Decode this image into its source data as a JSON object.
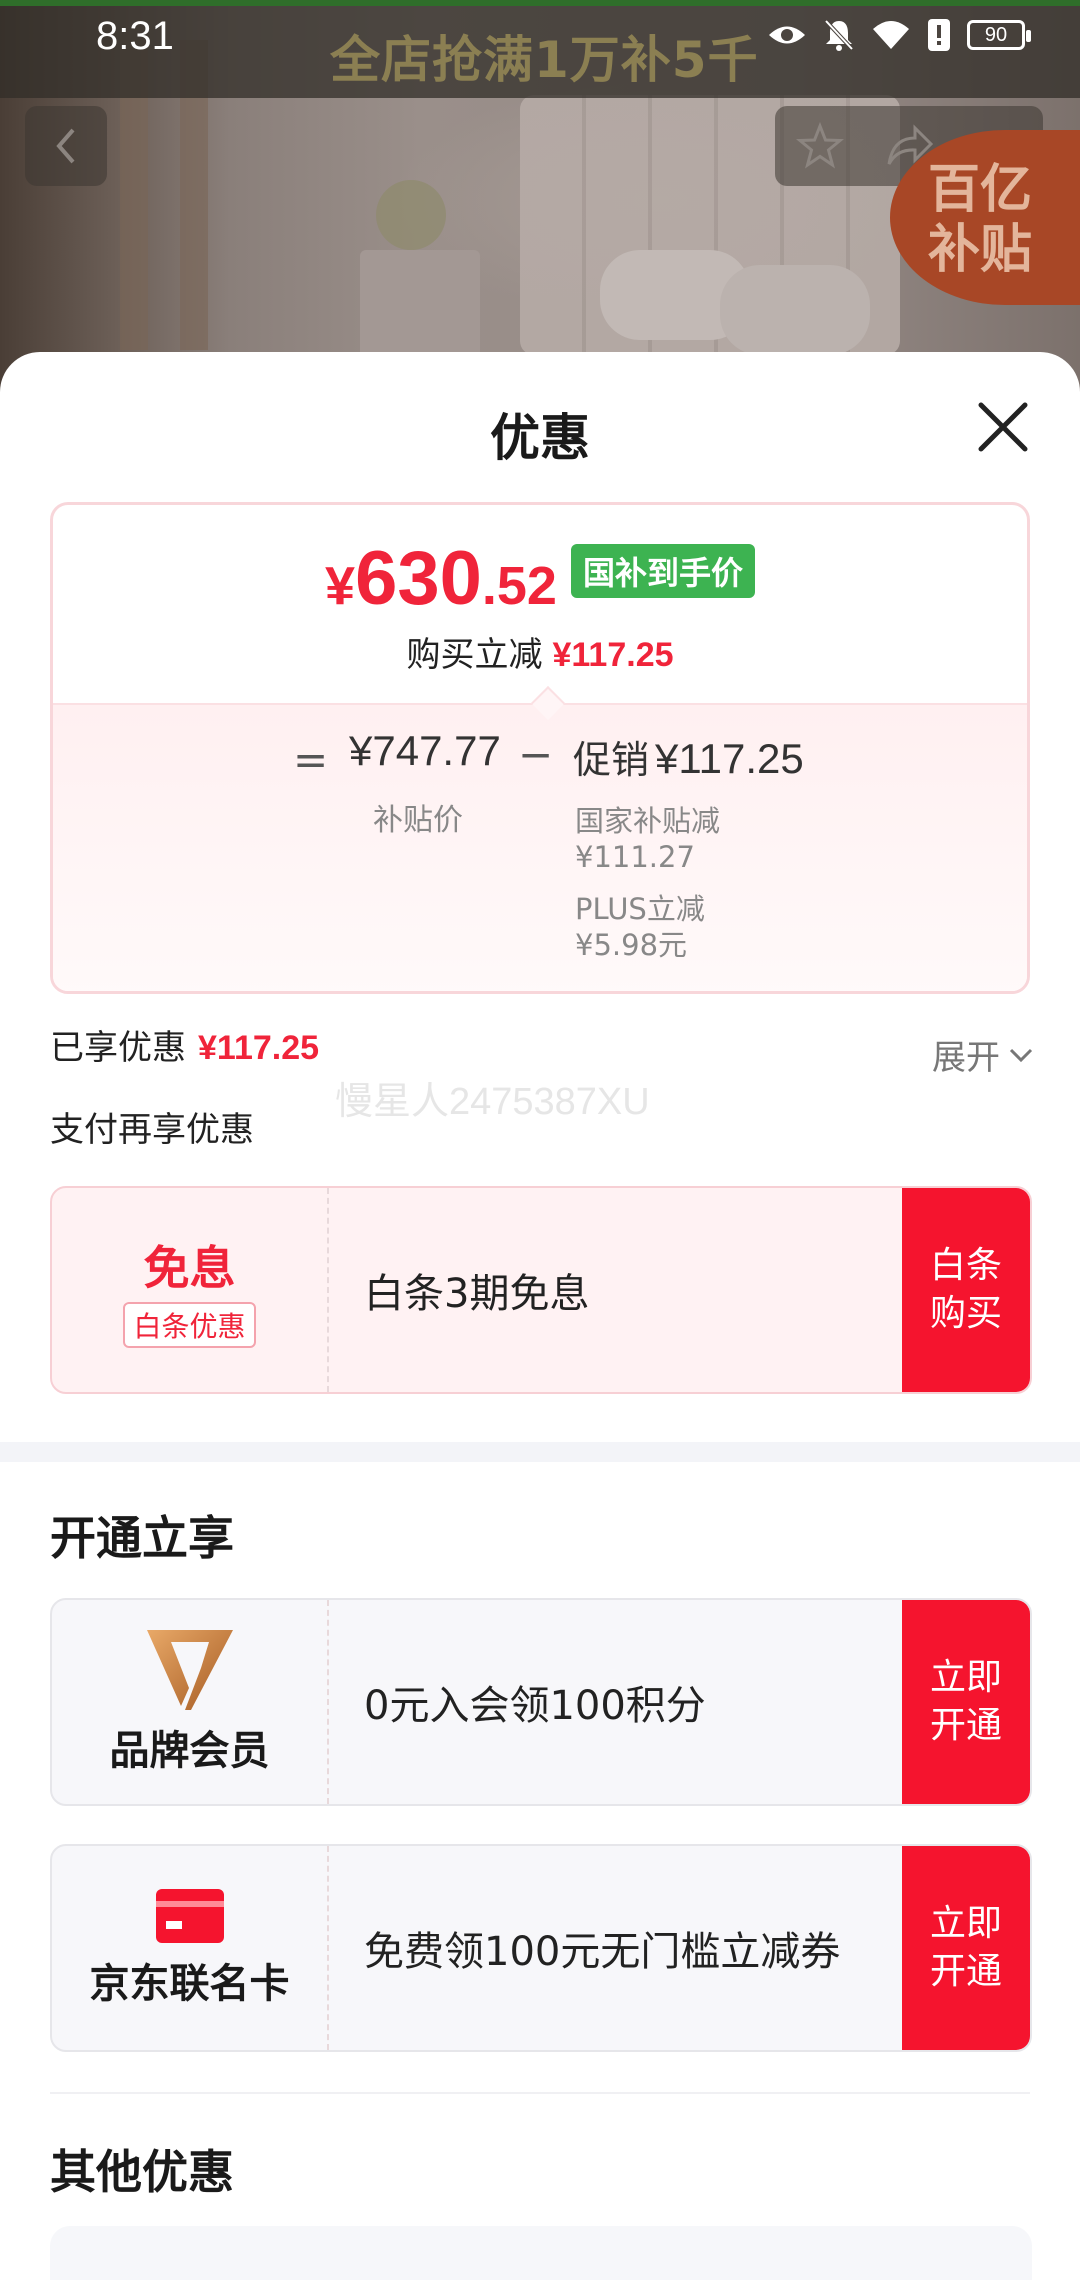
{
  "status_bar": {
    "time": "8:31",
    "battery": "90"
  },
  "banner": {
    "text": "全店抢满1万补5千",
    "badge_line1": "百亿",
    "badge_line2": "补贴"
  },
  "sheet": {
    "title": "优惠",
    "price_card": {
      "currency": "¥",
      "price_int": "630",
      "price_dec": ".52",
      "price_tag": "国补到手价",
      "instant_label": "购买立减",
      "instant_amount": "¥117.25",
      "subsidy_price": "¥747.77",
      "subsidy_label": "补贴价",
      "equals": "=",
      "minus": "−",
      "promo_label": "促销",
      "promo_amount": "¥117.25",
      "national_label": "国家补贴减",
      "national_amount": "¥111.27",
      "plus_label": "PLUS立减",
      "plus_amount": "¥5.98元"
    },
    "enjoyed_label": "已享优惠",
    "enjoyed_amount": "¥117.25",
    "expand_label": "展开",
    "watermark": "慢星人2475387XU",
    "pay_more_label": "支付再享优惠",
    "baitiao_offer": {
      "title": "免息",
      "badge": "白条优惠",
      "text": "白条3期免息",
      "button_line1": "白条",
      "button_line2": "购买"
    },
    "open_section_title": "开通立享",
    "brand_member": {
      "label": "品牌会员",
      "text": "0元入会领100积分",
      "button_line1": "立即",
      "button_line2": "开通"
    },
    "cobrand_card": {
      "label": "京东联名卡",
      "text": "免费领100元无门槛立减券",
      "button_line1": "立即",
      "button_line2": "开通"
    },
    "other_section_title": "其他优惠"
  },
  "colors": {
    "accent_red": "#f5142e",
    "price_red": "#f0243a",
    "tag_green": "#3db351"
  }
}
